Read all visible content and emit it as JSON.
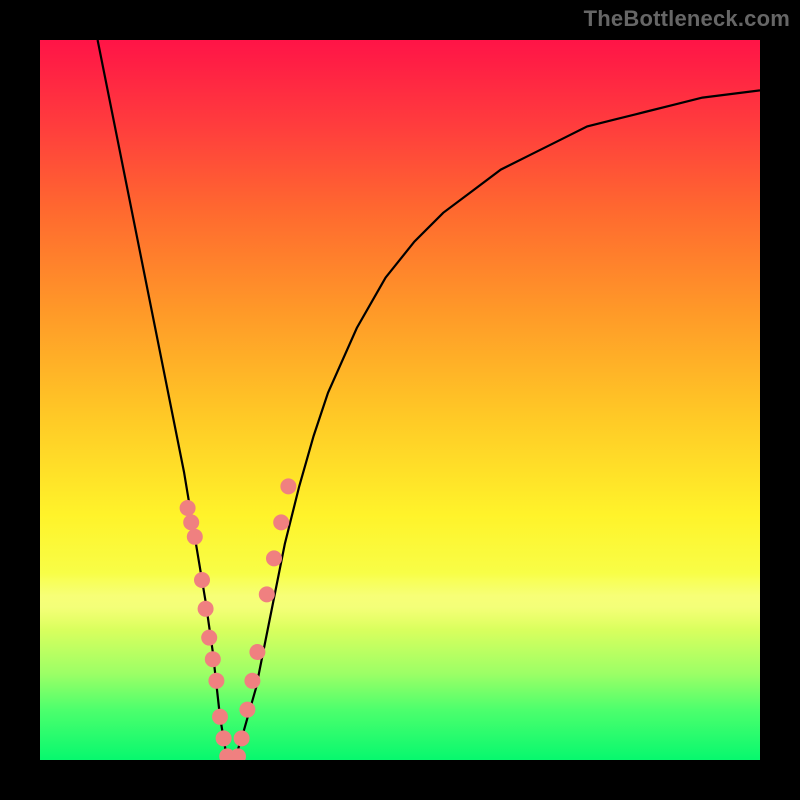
{
  "watermark": "TheBottleneck.com",
  "chart_data": {
    "type": "line",
    "title": "",
    "xlabel": "",
    "ylabel": "",
    "xlim": [
      0,
      100
    ],
    "ylim": [
      0,
      100
    ],
    "grid": false,
    "legend": false,
    "series": [
      {
        "name": "bottleneck-curve",
        "x": [
          8,
          10,
          12,
          14,
          16,
          18,
          20,
          22,
          23,
          24,
          25,
          26,
          27,
          28,
          30,
          32,
          34,
          36,
          38,
          40,
          44,
          48,
          52,
          56,
          60,
          64,
          68,
          72,
          76,
          80,
          84,
          88,
          92,
          96,
          100
        ],
        "y": [
          100,
          90,
          80,
          70,
          60,
          50,
          40,
          28,
          22,
          15,
          6,
          0,
          0,
          3,
          10,
          20,
          30,
          38,
          45,
          51,
          60,
          67,
          72,
          76,
          79,
          82,
          84,
          86,
          88,
          89,
          90,
          91,
          92,
          92.5,
          93
        ]
      }
    ],
    "markers": [
      {
        "x": 20.5,
        "y": 35
      },
      {
        "x": 21.0,
        "y": 33
      },
      {
        "x": 21.5,
        "y": 31
      },
      {
        "x": 22.5,
        "y": 25
      },
      {
        "x": 23.0,
        "y": 21
      },
      {
        "x": 23.5,
        "y": 17
      },
      {
        "x": 24.0,
        "y": 14
      },
      {
        "x": 24.5,
        "y": 11
      },
      {
        "x": 25.0,
        "y": 6
      },
      {
        "x": 25.5,
        "y": 3
      },
      {
        "x": 26.0,
        "y": 0.5
      },
      {
        "x": 26.8,
        "y": 0
      },
      {
        "x": 27.5,
        "y": 0.5
      },
      {
        "x": 28.0,
        "y": 3
      },
      {
        "x": 28.8,
        "y": 7
      },
      {
        "x": 29.5,
        "y": 11
      },
      {
        "x": 30.2,
        "y": 15
      },
      {
        "x": 31.5,
        "y": 23
      },
      {
        "x": 32.5,
        "y": 28
      },
      {
        "x": 33.5,
        "y": 33
      },
      {
        "x": 34.5,
        "y": 38
      }
    ],
    "marker_color": "#f08080",
    "curve_color": "#000000"
  }
}
